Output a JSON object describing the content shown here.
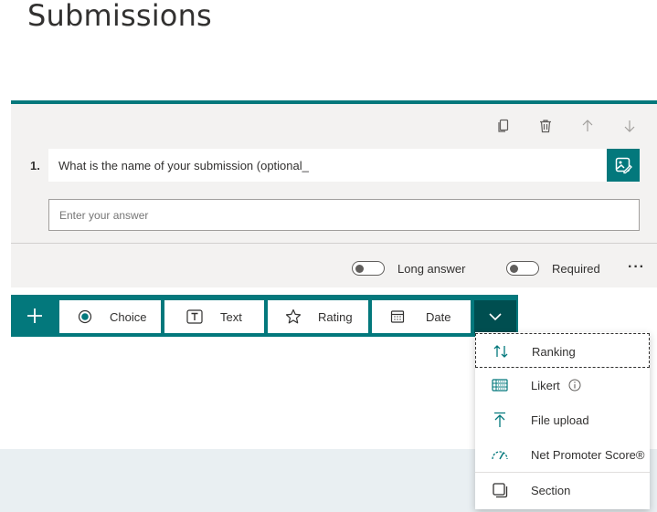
{
  "page": {
    "title": "Submissions"
  },
  "question": {
    "number": "1.",
    "title": "What is the name of your submission (optional_",
    "answer_placeholder": "Enter your answer",
    "toolbar": [
      "copy-icon",
      "delete-icon",
      "move-up-icon",
      "move-down-icon"
    ],
    "long_answer_label": "Long answer",
    "required_label": "Required",
    "more_label": "···"
  },
  "add_bar": {
    "plus_icon": "plus-icon",
    "types": [
      {
        "label": "Choice",
        "icon": "radio-icon"
      },
      {
        "label": "Text",
        "icon": "text-icon"
      },
      {
        "label": "Rating",
        "icon": "star-icon"
      },
      {
        "label": "Date",
        "icon": "calendar-icon"
      }
    ],
    "expand_icon": "chevron-down-icon"
  },
  "dropdown": {
    "items": [
      {
        "label": "Ranking",
        "icon": "ranking-icon",
        "focused": true
      },
      {
        "label": "Likert",
        "icon": "likert-icon"
      },
      {
        "label": "File upload",
        "icon": "upload-icon"
      },
      {
        "label": "Net Promoter Score®",
        "icon": "gauge-icon"
      },
      {
        "label": "Section",
        "icon": "section-icon"
      }
    ]
  },
  "colors": {
    "accent": "#03787c",
    "accent_dark": "#004e50",
    "card_bg": "#f3f2f1",
    "band_bg": "#e9eff2"
  }
}
